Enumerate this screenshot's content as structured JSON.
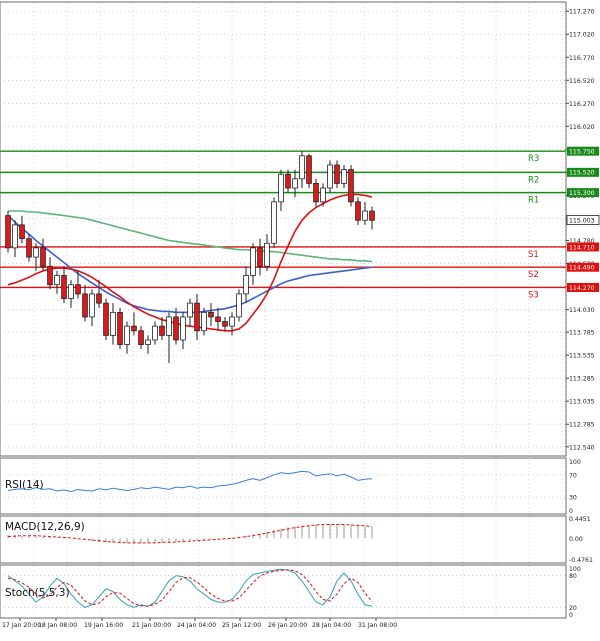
{
  "chart_data": {
    "type": "candlestick",
    "price_axis": {
      "ylim": [
        112.44,
        117.37
      ],
      "ticks": [
        "117.270",
        "117.020",
        "116.770",
        "116.520",
        "116.270",
        "116.020",
        "115.770",
        "115.520",
        "115.270",
        "115.020",
        "114.780",
        "114.530",
        "114.280",
        "114.030",
        "113.785",
        "113.535",
        "113.285",
        "113.035",
        "112.785",
        "112.540"
      ]
    },
    "current_price": "115.003",
    "levels": [
      {
        "name": "R3",
        "value": 115.75,
        "label": "115.750",
        "color": "#1a8a1a"
      },
      {
        "name": "R2",
        "value": 115.52,
        "label": "115.520",
        "color": "#1a8a1a"
      },
      {
        "name": "R1",
        "value": 115.3,
        "label": "115.300",
        "color": "#1a8a1a"
      },
      {
        "name": "S1",
        "value": 114.71,
        "label": "114.710",
        "color": "#e01010"
      },
      {
        "name": "S2",
        "value": 114.49,
        "label": "114.490",
        "color": "#e01010"
      },
      {
        "name": "S3",
        "value": 114.27,
        "label": "114.270",
        "color": "#e01010"
      }
    ],
    "x_labels": [
      "17 Jan 20:00",
      "18 Jan 08:00",
      "19 Jan 16:00",
      "21 Jan 00:00",
      "24 Jan 04:00",
      "25 Jan 12:00",
      "26 Jan 20:00",
      "28 Jan 04:00",
      "31 Jan 08:00"
    ],
    "candles": [
      [
        115.05,
        115.1,
        114.65,
        114.7
      ],
      [
        114.7,
        115.0,
        114.6,
        114.95
      ],
      [
        114.95,
        115.05,
        114.75,
        114.8
      ],
      [
        114.8,
        114.85,
        114.55,
        114.6
      ],
      [
        114.6,
        114.75,
        114.45,
        114.7
      ],
      [
        114.7,
        114.8,
        114.45,
        114.5
      ],
      [
        114.5,
        114.6,
        114.25,
        114.3
      ],
      [
        114.3,
        114.45,
        114.2,
        114.4
      ],
      [
        114.4,
        114.5,
        114.1,
        114.15
      ],
      [
        114.15,
        114.35,
        114.05,
        114.3
      ],
      [
        114.3,
        114.45,
        114.15,
        114.2
      ],
      [
        114.2,
        114.3,
        113.9,
        113.95
      ],
      [
        113.95,
        114.25,
        113.85,
        114.2
      ],
      [
        114.2,
        114.35,
        114.05,
        114.1
      ],
      [
        114.1,
        114.15,
        113.7,
        113.75
      ],
      [
        113.75,
        114.1,
        113.65,
        114.0
      ],
      [
        114.0,
        114.05,
        113.6,
        113.65
      ],
      [
        113.65,
        113.9,
        113.55,
        113.85
      ],
      [
        113.85,
        114.0,
        113.75,
        113.8
      ],
      [
        113.8,
        113.85,
        113.6,
        113.65
      ],
      [
        113.65,
        113.75,
        113.55,
        113.7
      ],
      [
        113.7,
        113.9,
        113.65,
        113.85
      ],
      [
        113.85,
        113.95,
        113.7,
        113.75
      ],
      [
        113.75,
        114.0,
        113.45,
        113.95
      ],
      [
        113.95,
        114.05,
        113.65,
        113.7
      ],
      [
        113.7,
        114.0,
        113.6,
        113.95
      ],
      [
        113.95,
        114.15,
        113.85,
        114.1
      ],
      [
        114.1,
        114.2,
        113.7,
        113.8
      ],
      [
        113.8,
        114.05,
        113.75,
        114.0
      ],
      [
        114.0,
        114.1,
        113.85,
        113.95
      ],
      [
        113.95,
        114.05,
        113.8,
        113.9
      ],
      [
        113.9,
        113.95,
        113.8,
        113.85
      ],
      [
        113.85,
        114.0,
        113.75,
        113.95
      ],
      [
        113.95,
        114.25,
        113.9,
        114.2
      ],
      [
        114.2,
        114.5,
        114.1,
        114.4
      ],
      [
        114.4,
        114.75,
        114.3,
        114.7
      ],
      [
        114.7,
        114.8,
        114.4,
        114.5
      ],
      [
        114.5,
        114.85,
        114.45,
        114.75
      ],
      [
        114.75,
        115.25,
        114.7,
        115.2
      ],
      [
        115.2,
        115.55,
        115.1,
        115.5
      ],
      [
        115.5,
        115.55,
        115.3,
        115.35
      ],
      [
        115.35,
        115.55,
        115.25,
        115.45
      ],
      [
        115.45,
        115.75,
        115.35,
        115.7
      ],
      [
        115.7,
        115.72,
        115.35,
        115.4
      ],
      [
        115.4,
        115.45,
        115.15,
        115.2
      ],
      [
        115.2,
        115.4,
        115.15,
        115.35
      ],
      [
        115.35,
        115.65,
        115.3,
        115.6
      ],
      [
        115.6,
        115.65,
        115.35,
        115.4
      ],
      [
        115.4,
        115.6,
        115.35,
        115.55
      ],
      [
        115.55,
        115.6,
        115.15,
        115.2
      ],
      [
        115.2,
        115.25,
        114.95,
        115.0
      ],
      [
        115.0,
        115.2,
        114.95,
        115.1
      ],
      [
        115.1,
        115.15,
        114.9,
        115.0
      ]
    ],
    "ema_red": [
      114.3,
      114.32,
      114.35,
      114.38,
      114.42,
      114.45,
      114.47,
      114.48,
      114.48,
      114.47,
      114.45,
      114.42,
      114.38,
      114.33,
      114.28,
      114.22,
      114.17,
      114.11,
      114.06,
      114.02,
      113.98,
      113.95,
      113.92,
      113.9,
      113.88,
      113.86,
      113.85,
      113.84,
      113.83,
      113.82,
      113.81,
      113.8,
      113.8,
      113.82,
      113.88,
      113.98,
      114.08,
      114.2,
      114.36,
      114.55,
      114.72,
      114.88,
      115.0,
      115.08,
      115.14,
      115.18,
      115.22,
      115.25,
      115.27,
      115.28,
      115.28,
      115.27,
      115.25
    ],
    "ma_blue": [
      115.05,
      114.98,
      114.91,
      114.85,
      114.78,
      114.72,
      114.66,
      114.6,
      114.54,
      114.48,
      114.42,
      114.37,
      114.32,
      114.27,
      114.22,
      114.18,
      114.14,
      114.1,
      114.07,
      114.05,
      114.03,
      114.02,
      114.01,
      114.01,
      114.0,
      114.0,
      114.0,
      114.0,
      114.01,
      114.02,
      114.03,
      114.04,
      114.06,
      114.08,
      114.11,
      114.15,
      114.19,
      114.23,
      114.27,
      114.31,
      114.34,
      114.36,
      114.38,
      114.4,
      114.41,
      114.42,
      114.43,
      114.44,
      114.45,
      114.46,
      114.47,
      114.48,
      114.49
    ],
    "ma_green": [
      115.1,
      115.1,
      115.1,
      115.09,
      115.09,
      115.08,
      115.07,
      115.06,
      115.05,
      115.04,
      115.03,
      115.02,
      115.0,
      114.98,
      114.96,
      114.94,
      114.92,
      114.9,
      114.88,
      114.86,
      114.84,
      114.82,
      114.8,
      114.78,
      114.77,
      114.76,
      114.75,
      114.74,
      114.73,
      114.72,
      114.71,
      114.7,
      114.69,
      114.68,
      114.68,
      114.67,
      114.67,
      114.66,
      114.66,
      114.65,
      114.64,
      114.63,
      114.62,
      114.61,
      114.6,
      114.59,
      114.58,
      114.58,
      114.57,
      114.57,
      114.56,
      114.56,
      114.55
    ],
    "rsi": {
      "label": "RSI(14)",
      "ylim": [
        0,
        100
      ],
      "ticks": [
        "100",
        "70",
        "30",
        "0"
      ],
      "values": [
        42,
        44,
        45,
        43,
        47,
        44,
        45,
        41,
        43,
        40,
        44,
        42,
        41,
        45,
        43,
        46,
        44,
        42,
        44,
        47,
        45,
        48,
        46,
        44,
        48,
        47,
        50,
        46,
        48,
        47,
        50,
        51,
        53,
        56,
        60,
        63,
        60,
        65,
        70,
        74,
        72,
        74,
        76,
        75,
        68,
        70,
        72,
        68,
        71,
        66,
        60,
        62,
        63
      ]
    },
    "macd": {
      "label": "MACD(12,26,9)",
      "ylim": [
        -0.55,
        0.5
      ],
      "ticks": [
        "0.4451",
        "0.00",
        "-0.4761"
      ],
      "histogram": [
        0.08,
        0.07,
        0.06,
        0.05,
        0.05,
        0.04,
        0.03,
        0.02,
        0.01,
        0.0,
        -0.02,
        -0.04,
        -0.06,
        -0.08,
        -0.09,
        -0.1,
        -0.11,
        -0.11,
        -0.11,
        -0.11,
        -0.1,
        -0.1,
        -0.09,
        -0.08,
        -0.07,
        -0.06,
        -0.05,
        -0.04,
        -0.03,
        -0.02,
        -0.01,
        0.0,
        0.02,
        0.04,
        0.06,
        0.09,
        0.12,
        0.15,
        0.19,
        0.22,
        0.25,
        0.27,
        0.29,
        0.3,
        0.31,
        0.31,
        0.32,
        0.32,
        0.31,
        0.3,
        0.29,
        0.27,
        0.25
      ],
      "signal": [
        0.04,
        0.05,
        0.06,
        0.06,
        0.06,
        0.05,
        0.04,
        0.03,
        0.02,
        0.01,
        -0.01,
        -0.02,
        -0.04,
        -0.05,
        -0.07,
        -0.08,
        -0.09,
        -0.1,
        -0.1,
        -0.1,
        -0.1,
        -0.1,
        -0.09,
        -0.09,
        -0.08,
        -0.07,
        -0.06,
        -0.05,
        -0.04,
        -0.03,
        -0.02,
        -0.01,
        0.0,
        0.02,
        0.04,
        0.06,
        0.09,
        0.12,
        0.15,
        0.18,
        0.21,
        0.24,
        0.26,
        0.28,
        0.3,
        0.31,
        0.31,
        0.31,
        0.31,
        0.3,
        0.29,
        0.28,
        0.26
      ]
    },
    "stoch": {
      "label": "Stoch(5,5,3)",
      "ylim": [
        0,
        100
      ],
      "ticks": [
        "100",
        "80",
        "20",
        "0"
      ],
      "k": [
        80,
        70,
        60,
        45,
        30,
        40,
        60,
        75,
        65,
        45,
        30,
        20,
        25,
        40,
        55,
        50,
        35,
        25,
        20,
        25,
        22,
        30,
        50,
        70,
        80,
        78,
        70,
        55,
        45,
        35,
        30,
        30,
        35,
        50,
        70,
        82,
        85,
        88,
        90,
        92,
        90,
        85,
        70,
        50,
        30,
        25,
        40,
        70,
        85,
        70,
        45,
        25,
        22
      ],
      "d": [
        75,
        72,
        66,
        58,
        45,
        38,
        43,
        58,
        67,
        62,
        47,
        32,
        25,
        28,
        40,
        48,
        47,
        37,
        27,
        23,
        22,
        26,
        34,
        50,
        67,
        76,
        76,
        68,
        57,
        45,
        37,
        32,
        32,
        38,
        52,
        67,
        79,
        85,
        88,
        90,
        91,
        89,
        82,
        68,
        50,
        35,
        32,
        45,
        65,
        75,
        67,
        47,
        31
      ]
    }
  }
}
